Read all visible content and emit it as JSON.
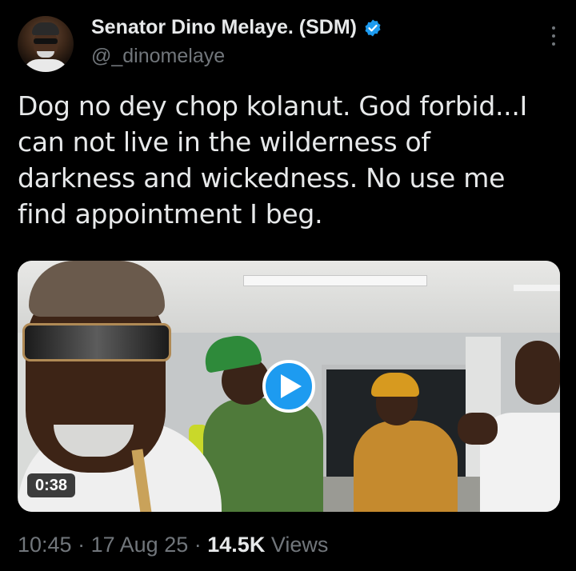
{
  "author": {
    "name": "Senator Dino Melaye. (SDM)",
    "handle": "@_dinomelaye",
    "verified": true,
    "verified_color": "#1d9bf0"
  },
  "tweet": {
    "text": "Dog no dey chop kolanut. God forbid...I can not live in the wilderness of darkness and wickedness. No use me find appointment I beg."
  },
  "media": {
    "type": "video",
    "duration": "0:38",
    "play_icon": "play-icon",
    "play_color": "#1d9bf0"
  },
  "meta": {
    "time": "10:45",
    "sep1": "·",
    "date": "17 Aug 25",
    "sep2": "·",
    "views_count": "14.5K",
    "views_label": "Views"
  },
  "icons": {
    "more": "more-options-icon",
    "verified": "verified-badge-icon"
  },
  "colors": {
    "background": "#000000",
    "text": "#e7e9ea",
    "secondary": "#71767b",
    "accent": "#1d9bf0"
  }
}
